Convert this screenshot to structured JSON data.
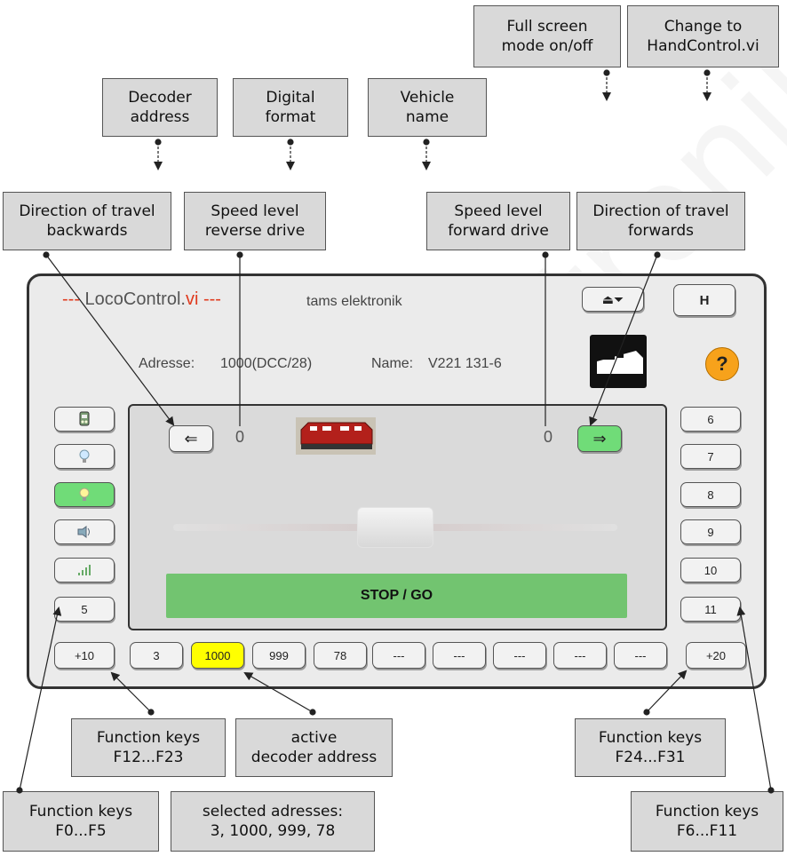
{
  "callouts": {
    "decoder_address": "Decoder\naddress",
    "digital_format": "Digital\nformat",
    "vehicle_name": "Vehicle\nname",
    "fullscreen": "Full screen\nmode on/off",
    "handcontrol": "Change to\nHandControl.vi",
    "dir_backwards": "Direction of travel\nbackwards",
    "speed_reverse": "Speed level\nreverse drive",
    "speed_forward": "Speed level\nforward drive",
    "dir_forwards": "Direction of travel\nforwards",
    "fk_f12_f23": "Function keys\nF12...F23",
    "active_address": "active\ndecoder address",
    "fk_f24_f31": "Function keys\nF24...F31",
    "fk_f0_f5": "Function keys\nF0...F5",
    "selected_addresses": "selected adresses:\n3, 1000, 999, 78",
    "fk_f6_f11": "Function keys\nF6...F11"
  },
  "app": {
    "title_dashes_left": "---",
    "title_main": "LocoControl.",
    "title_ext": "vi",
    "title_dashes_right": "---",
    "brand": "tams elektronik",
    "address_label": "Adresse:",
    "address_value": "1000(DCC/28)",
    "name_label": "Name:",
    "name_value": "V221 131-6",
    "h_button": "H",
    "eject_glyph": "⏏⏷",
    "help_glyph": "?",
    "dir_back_glyph": "⇐",
    "dir_fwd_glyph": "⇒",
    "speed_reverse": "0",
    "speed_forward": "0",
    "stop_go": "STOP / GO",
    "fkeys_left": [
      {
        "label": "",
        "icon": "loco-light-icon"
      },
      {
        "label": "",
        "icon": "bulb-icon"
      },
      {
        "label": "",
        "icon": "bulb-icon",
        "active": true
      },
      {
        "label": "",
        "icon": "sound-icon"
      },
      {
        "label": "",
        "icon": "signal-icon"
      },
      {
        "label": "5"
      }
    ],
    "fkeys_right": [
      "6",
      "7",
      "8",
      "9",
      "10",
      "11"
    ],
    "plus10": "+10",
    "plus20": "+20",
    "address_slots": [
      "3",
      "1000",
      "999",
      "78",
      "---",
      "---",
      "---",
      "---",
      "---"
    ],
    "active_slot": "1000"
  },
  "watermark": "elektronik",
  "colors": {
    "active_green": "#70dc78",
    "active_yellow": "#ffff00",
    "title_red": "#e03a1e",
    "help_orange": "#f7a21b",
    "stop_green": "#72c470"
  }
}
